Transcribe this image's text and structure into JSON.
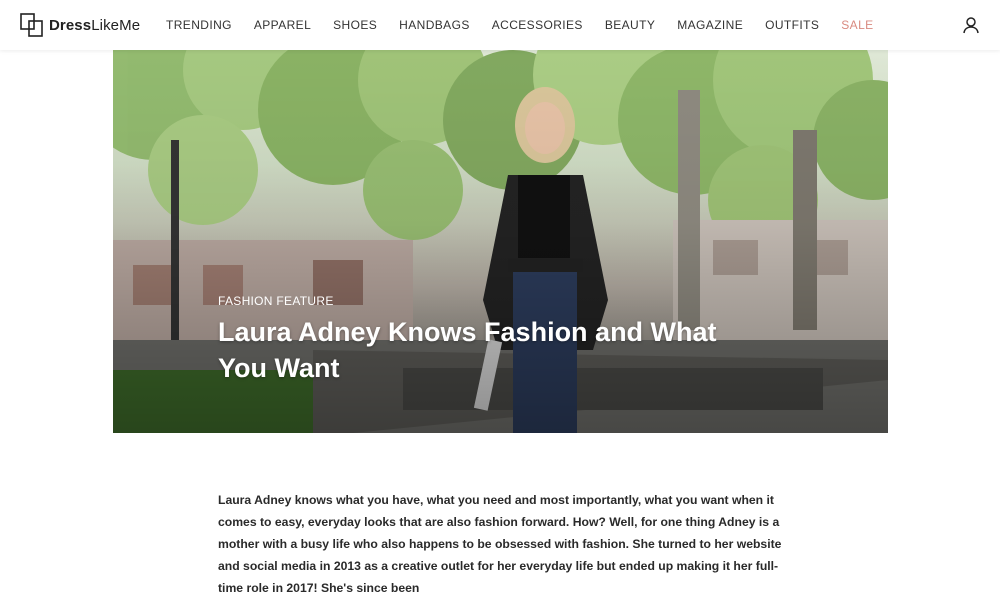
{
  "header": {
    "logo_bold": "Dress",
    "logo_regular": "LikeMe",
    "nav": [
      {
        "label": "TRENDING",
        "name": "nav-item-trending"
      },
      {
        "label": "APPAREL",
        "name": "nav-item-apparel"
      },
      {
        "label": "SHOES",
        "name": "nav-item-shoes"
      },
      {
        "label": "HANDBAGS",
        "name": "nav-item-handbags"
      },
      {
        "label": "ACCESSORIES",
        "name": "nav-item-accessories"
      },
      {
        "label": "BEAUTY",
        "name": "nav-item-beauty"
      },
      {
        "label": "MAGAZINE",
        "name": "nav-item-magazine"
      },
      {
        "label": "OUTFITS",
        "name": "nav-item-outfits"
      },
      {
        "label": "SALE",
        "name": "nav-item-sale"
      }
    ],
    "user_icon": "user-icon",
    "sale_color": "#d98a80"
  },
  "hero": {
    "category": "FASHION FEATURE",
    "title": "Laura Adney Knows Fashion and What You Want"
  },
  "article": {
    "body": "Laura Adney knows what you have, what you need and most importantly, what you want when it comes to easy, everyday looks that are also fashion forward. How? Well, for one thing Adney is a mother with a busy life who also happens to be obsessed with fashion. She turned to her website and social media in 2013 as a creative outlet for her everyday life but ended up making it her full-time role in 2017! She's since been"
  }
}
